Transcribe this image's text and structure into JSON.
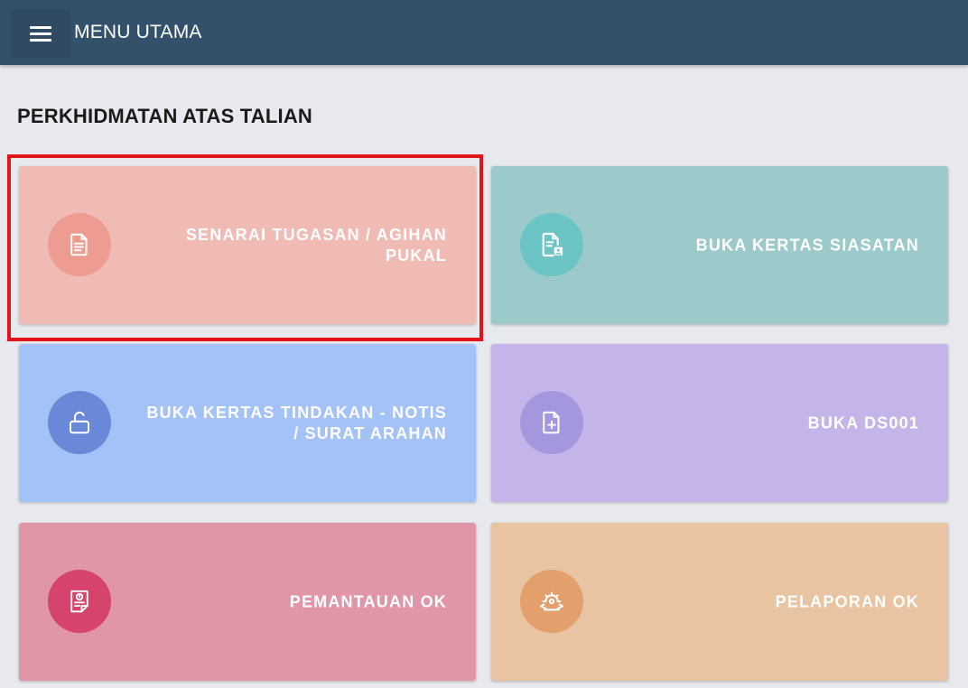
{
  "header": {
    "title": "MENU UTAMA",
    "background": "#34516b"
  },
  "section": {
    "title": "PERKHIDMATAN ATAS TALIAN"
  },
  "cards": [
    {
      "label": "SENARAI TUGASAN / AGIHAN PUKAL",
      "icon": "document-list-icon",
      "bg": "#f0bab5",
      "icon_bg": "#ee9c92"
    },
    {
      "label": "BUKA KERTAS SIASATAN",
      "icon": "document-person-icon",
      "bg": "#9ccaca",
      "icon_bg": "#6cc4c4"
    },
    {
      "label": "BUKA KERTAS TINDAKAN - NOTIS / SURAT ARAHAN",
      "icon": "unlock-icon",
      "bg": "#a3c2f7",
      "icon_bg": "#6a88d8"
    },
    {
      "label": "BUKA DS001",
      "icon": "file-plus-icon",
      "bg": "#c4b4ea",
      "icon_bg": "#a597dd"
    },
    {
      "label": "PEMANTAUAN OK",
      "icon": "report-alert-icon",
      "bg": "#e196a8",
      "icon_bg": "#d6436c"
    },
    {
      "label": "PELAPORAN OK",
      "icon": "gear-tools-icon",
      "bg": "#e8c4a2",
      "icon_bg": "#e3a06c"
    }
  ],
  "highlight_color": "#e0141b"
}
